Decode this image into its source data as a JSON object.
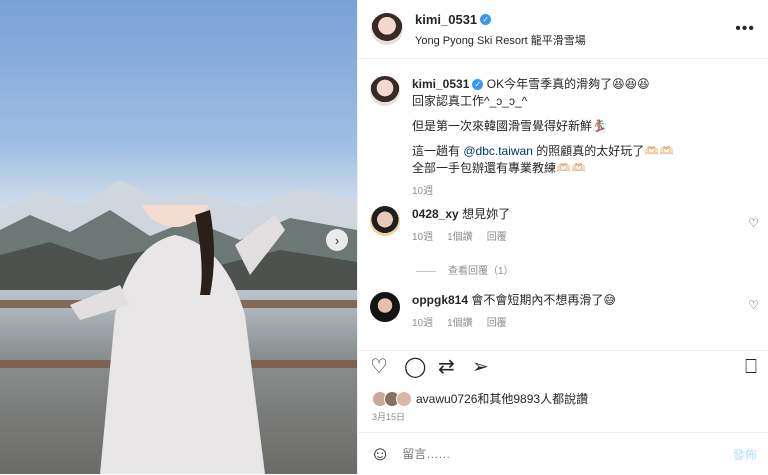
{
  "header": {
    "username": "kimi_0531",
    "location": "Yong Pyong Ski Resort 龍平滑雪場",
    "more_icon": "more-dots-icon"
  },
  "caption": {
    "username": "kimi_0531",
    "line1": "OK今年雪季真的滑夠了😆😆😆",
    "line2": "回家認真工作^_ↄ_ↄ_^",
    "line3": "但是第一次來韓國滑雪覺得好新鮮🏂",
    "line4_pre": "這一趟有 ",
    "mention": "@dbc.taiwan",
    "line4_post": " 的照顧真的太好玩了🫶🏻🫶🏻",
    "line5": "全部一手包辦還有專業教練🫶🏻🫶🏻",
    "time": "10週"
  },
  "comments": [
    {
      "username": "0428_xy",
      "text": "想見妳了",
      "time": "10週",
      "likes": "1個讚",
      "reply": "回覆",
      "view_replies": "查看回覆（1）"
    },
    {
      "username": "oppgk814",
      "text": "會不會短期內不想再滑了😅",
      "time": "10週",
      "likes": "1個讚",
      "reply": "回覆"
    }
  ],
  "likes_text": "avawu0726和其他9893人都說讚",
  "date": "3月15日",
  "comment_input": {
    "placeholder": "留言……",
    "post_label": "發佈"
  },
  "colors": {
    "verified": "#3897f0",
    "mention": "#00376b",
    "post_disabled": "#b2dffc"
  }
}
